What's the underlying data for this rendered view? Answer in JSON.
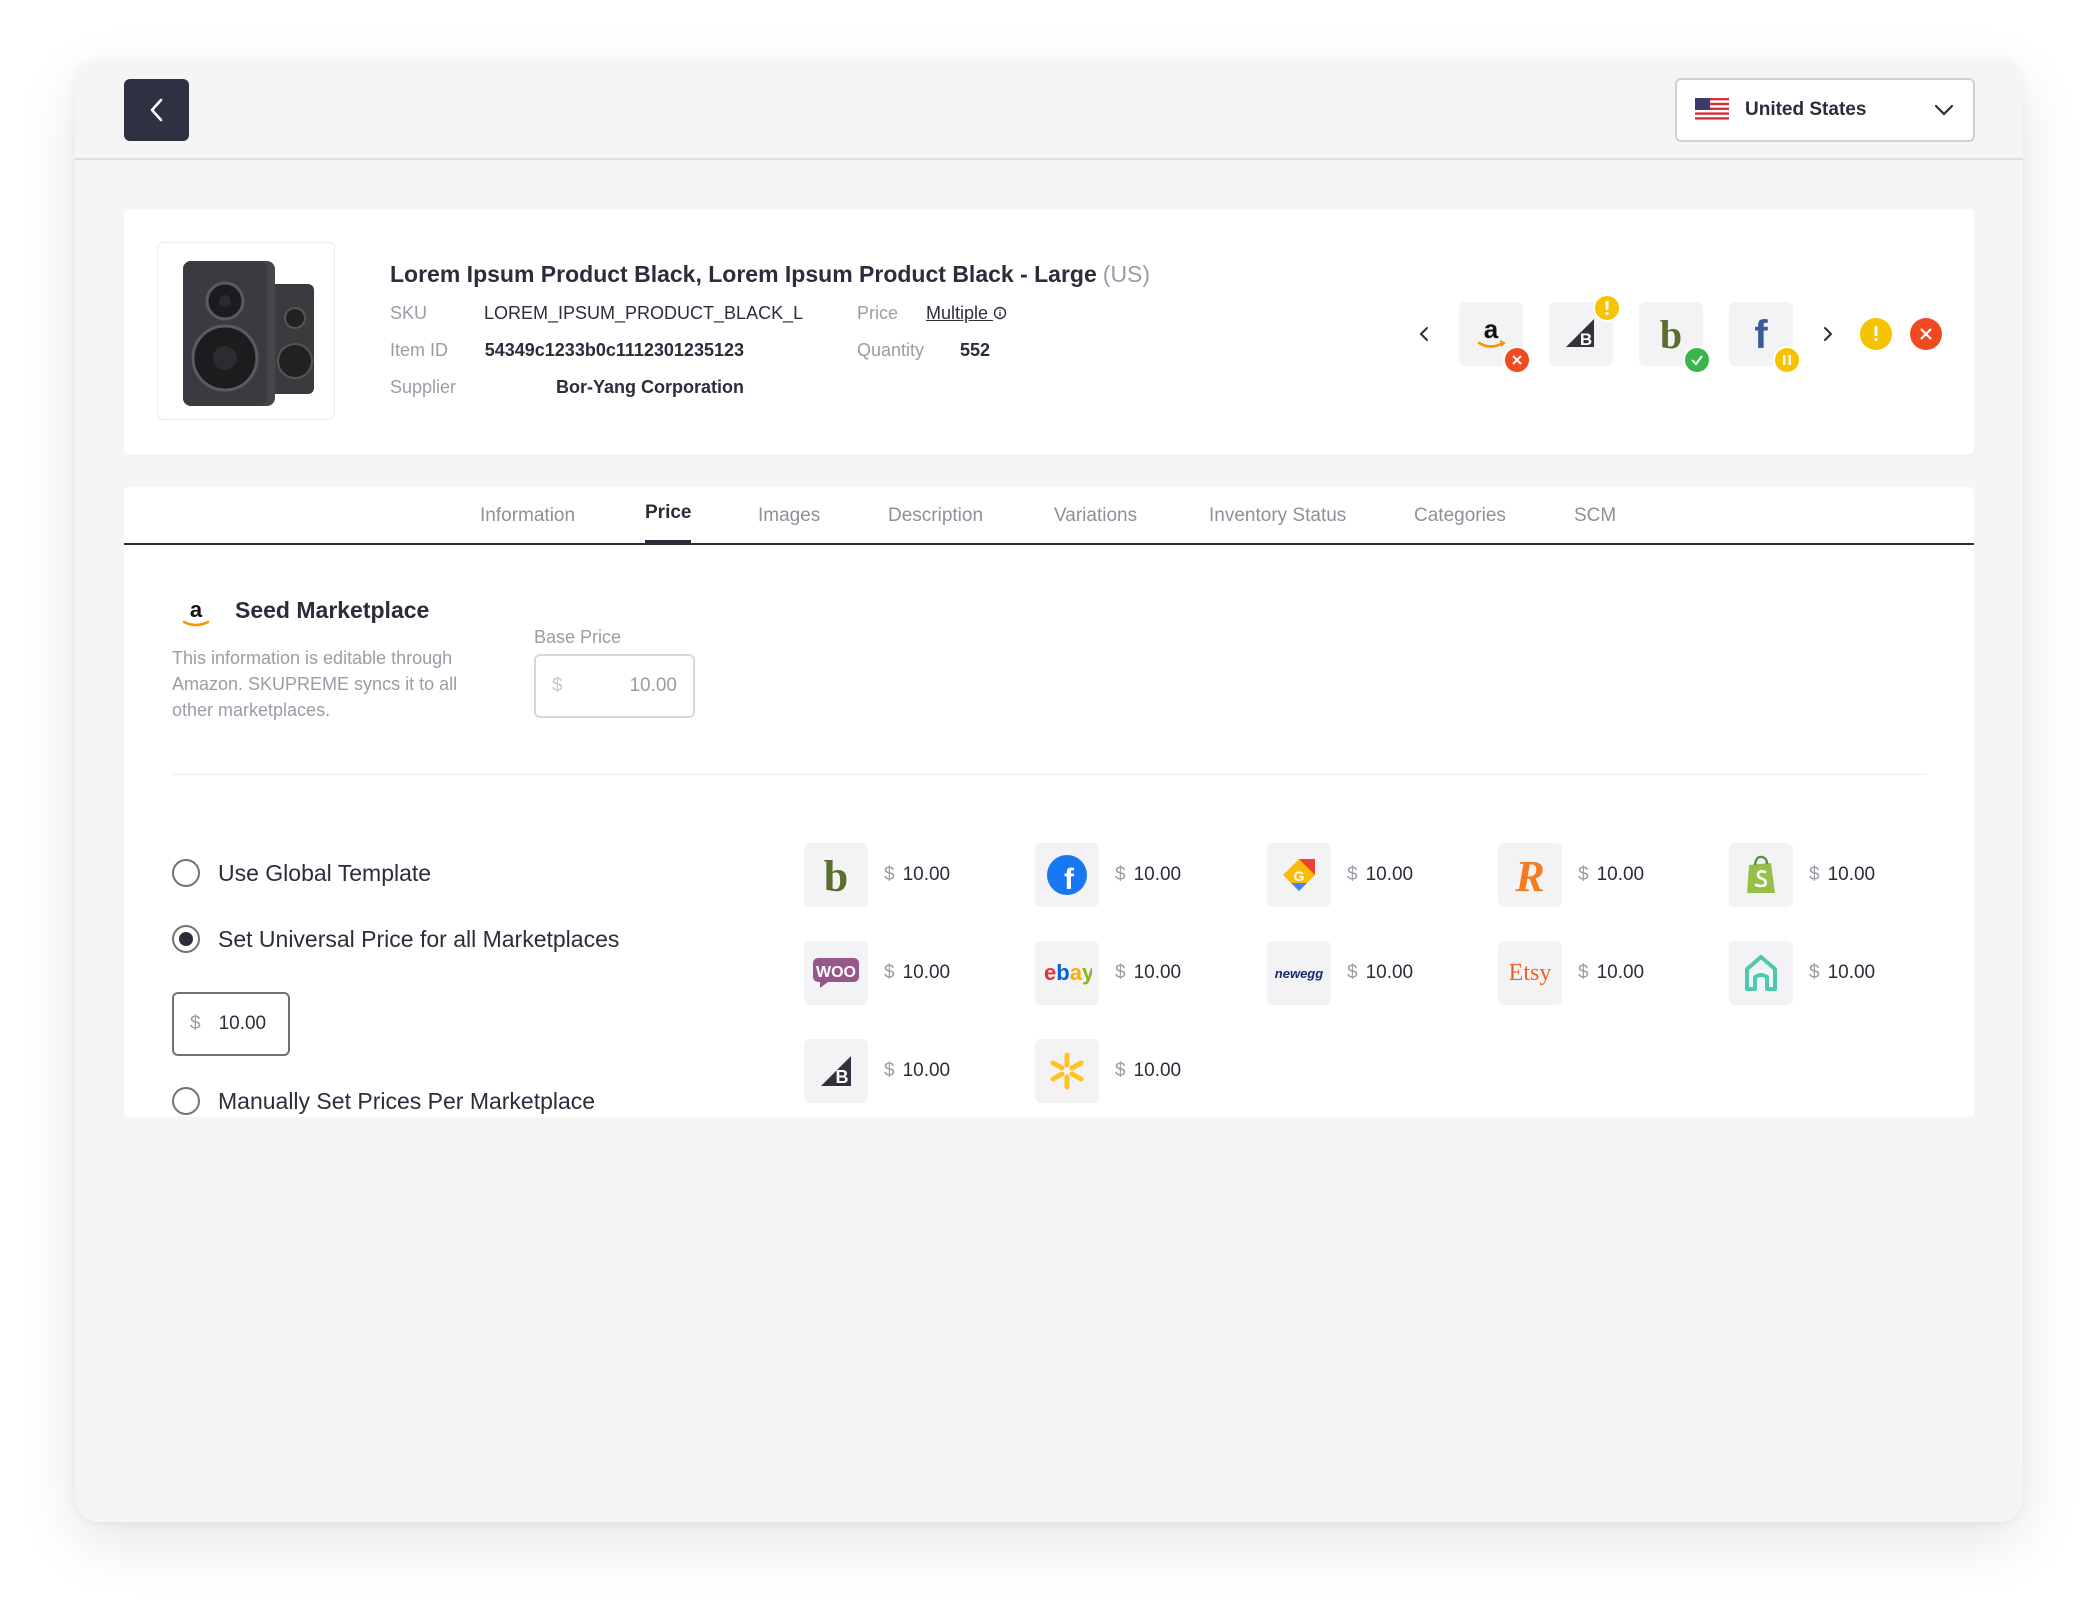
{
  "header": {
    "country": "United States"
  },
  "product": {
    "title": "Lorem Ipsum Product Black, Lorem Ipsum Product Black - Large",
    "region": "(US)",
    "sku_label": "SKU",
    "sku": "LOREM_IPSUM_PRODUCT_BLACK_L",
    "item_id_label": "Item ID",
    "item_id": "54349c1233b0c1112301235123",
    "supplier_label": "Supplier",
    "supplier": "Bor-Yang Corporation",
    "price_label": "Price",
    "price": "Multiple",
    "quantity_label": "Quantity",
    "quantity": "552"
  },
  "status_marketplaces": [
    {
      "name": "amazon",
      "icon": "amazon-icon",
      "status": "error"
    },
    {
      "name": "bigcommerce",
      "icon": "bigcommerce-icon",
      "status": "warning"
    },
    {
      "name": "bonanza",
      "icon": "bonanza-icon",
      "status": "success"
    },
    {
      "name": "facebook",
      "icon": "facebook-icon",
      "status": "paused"
    }
  ],
  "tabs": [
    "Information",
    "Price",
    "Images",
    "Description",
    "Variations",
    "Inventory Status",
    "Categories",
    "SCM"
  ],
  "active_tab": "Price",
  "seed": {
    "title": "Seed Marketplace",
    "description": "This information is editable through Amazon. SKUPREME syncs it to all other marketplaces.",
    "base_price_label": "Base Price",
    "currency": "$",
    "base_price": "10.00"
  },
  "options": {
    "global_template": "Use Global Template",
    "universal": "Set Universal Price for all Marketplaces",
    "universal_price": "10.00",
    "manual": "Manually Set Prices Per Marketplace",
    "selected": "universal"
  },
  "marketplace_prices": [
    {
      "name": "bonanza",
      "icon": "bonanza-icon",
      "price": "10.00"
    },
    {
      "name": "facebook",
      "icon": "facebook-icon",
      "price": "10.00"
    },
    {
      "name": "google",
      "icon": "google-shopping-icon",
      "price": "10.00"
    },
    {
      "name": "reverb",
      "icon": "reverb-icon",
      "price": "10.00"
    },
    {
      "name": "shopify",
      "icon": "shopify-icon",
      "price": "10.00"
    },
    {
      "name": "woocommerce",
      "icon": "woocommerce-icon",
      "price": "10.00"
    },
    {
      "name": "ebay",
      "icon": "ebay-icon",
      "price": "10.00"
    },
    {
      "name": "newegg",
      "icon": "newegg-icon",
      "price": "10.00"
    },
    {
      "name": "etsy",
      "icon": "etsy-icon",
      "price": "10.00"
    },
    {
      "name": "houzz",
      "icon": "houzz-icon",
      "price": "10.00"
    },
    {
      "name": "bigcommerce",
      "icon": "bigcommerce-icon",
      "price": "10.00"
    },
    {
      "name": "walmart",
      "icon": "walmart-icon",
      "price": "10.00"
    }
  ],
  "logos": {
    "woo": "WOO",
    "ebay_e": "e",
    "ebay_b": "b",
    "ebay_a": "a",
    "ebay_y": "y",
    "newegg": "newegg",
    "etsy": "Etsy",
    "amazon": "a",
    "bonanza": "b",
    "facebook": "f",
    "reverb": "R",
    "google": "G",
    "bigcommerce": "B"
  },
  "colors": {
    "primary_dark": "#2f3041",
    "error": "#f04a23",
    "warning": "#f5c300",
    "success": "#3bb54a"
  }
}
